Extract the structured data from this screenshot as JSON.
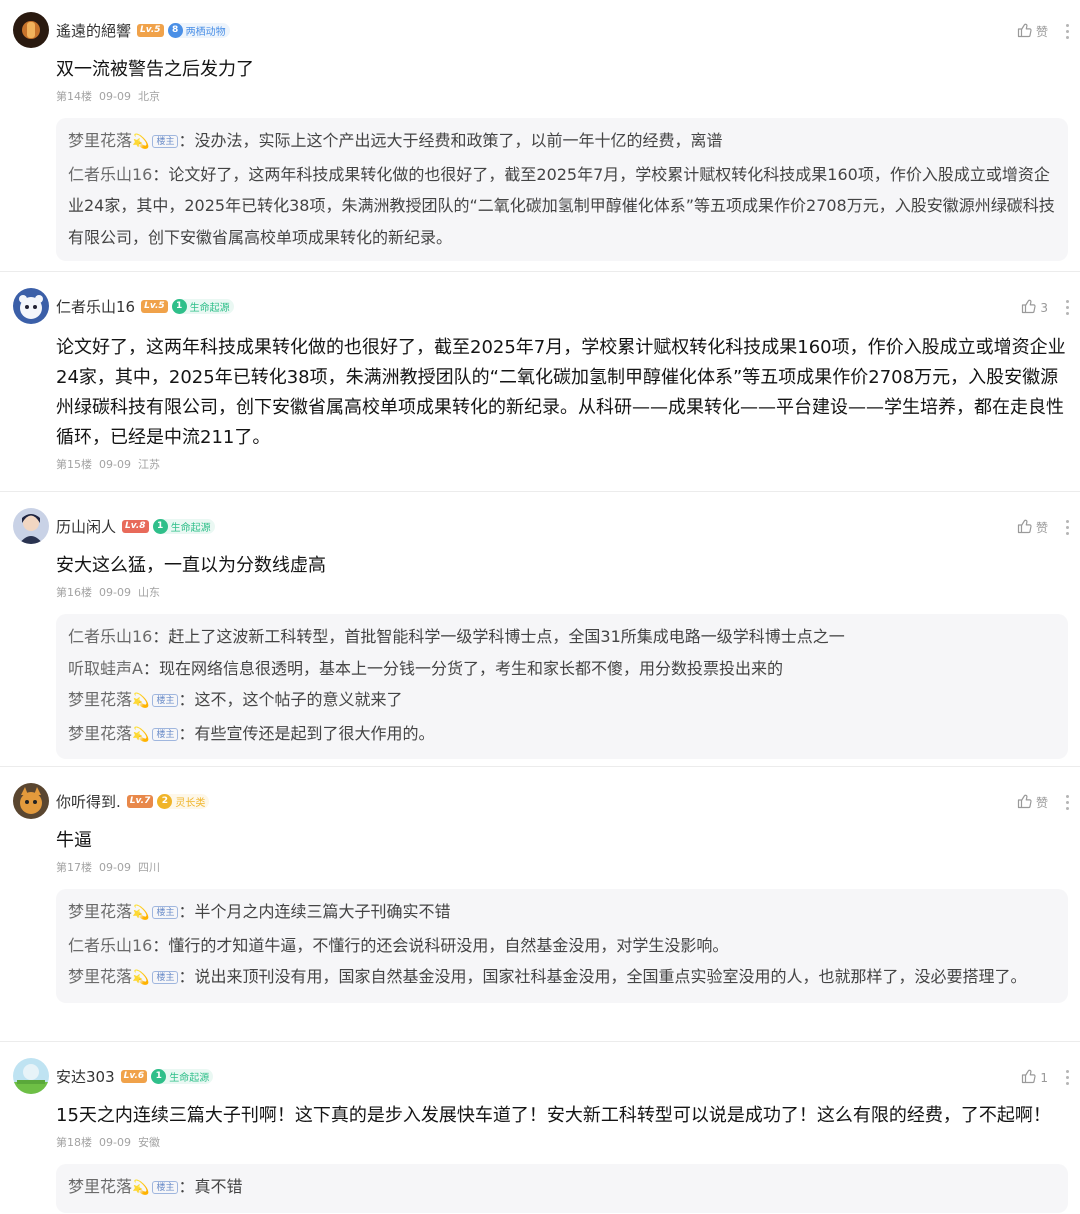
{
  "ui": {
    "colon": "：",
    "host_tag": "楼主",
    "spark": "💫",
    "icons": {
      "like": "thumb-up-icon",
      "more": "more-vertical-icon"
    }
  },
  "posts": [
    {
      "user": "遙遠的絕響",
      "level": "Lv.5",
      "level_color": "#f0a24a",
      "badge_num": "8",
      "badge_text": "两栖动物",
      "badge_color": "#4a8fe6",
      "like": "赞",
      "content": "双一流被警告之后发力了",
      "floor": "第14楼",
      "date": "09-09",
      "location": "北京",
      "replies": [
        {
          "name": "梦里花落",
          "host": true,
          "text": "没办法，实际上这个产出远大于经费和政策了，以前一年十亿的经费，离谱"
        },
        {
          "name": "仁者乐山16",
          "host": false,
          "text": "论文好了，这两年科技成果转化做的也很好了，截至2025年7月，学校累计赋权转化科技成果160项，作价入股成立或增资企业24家，其中，2025年已转化38项，朱满洲教授团队的“二氧化碳加氢制甲醇催化体系”等五项成果作价2708万元，入股安徽源州绿碳科技有限公司，创下安徽省属高校单项成果转化的新纪录。"
        }
      ]
    },
    {
      "user": "仁者乐山16",
      "level": "Lv.5",
      "level_color": "#f0a24a",
      "badge_num": "1",
      "badge_text": "生命起源",
      "badge_color": "#2fbf8a",
      "like": "3",
      "content": "论文好了，这两年科技成果转化做的也很好了，截至2025年7月，学校累计赋权转化科技成果160项，作价入股成立或增资企业24家，其中，2025年已转化38项，朱满洲教授团队的“二氧化碳加氢制甲醇催化体系”等五项成果作价2708万元，入股安徽源州绿碳科技有限公司，创下安徽省属高校单项成果转化的新纪录。从科研——成果转化——平台建设——学生培养，都在走良性循环，已经是中流211了。",
      "floor": "第15楼",
      "date": "09-09",
      "location": "江苏",
      "replies": []
    },
    {
      "user": "历山闲人",
      "level": "Lv.8",
      "level_color": "#e86a5a",
      "badge_num": "1",
      "badge_text": "生命起源",
      "badge_color": "#2fbf8a",
      "like": "赞",
      "content": "安大这么猛，一直以为分数线虚高",
      "floor": "第16楼",
      "date": "09-09",
      "location": "山东",
      "replies": [
        {
          "name": "仁者乐山16",
          "host": false,
          "text": "赶上了这波新工科转型，首批智能科学一级学科博士点，全国31所集成电路一级学科博士点之一"
        },
        {
          "name": "听取蛙声A",
          "host": false,
          "text": "现在网络信息很透明，基本上一分钱一分货了，考生和家长都不傻，用分数投票投出来的"
        },
        {
          "name": "梦里花落",
          "host": true,
          "text": "这不，这个帖子的意义就来了"
        },
        {
          "name": "梦里花落",
          "host": true,
          "text": "有些宣传还是起到了很大作用的。"
        }
      ]
    },
    {
      "user": "你听得到.",
      "level": "Lv.7",
      "level_color": "#e8884a",
      "badge_num": "2",
      "badge_text": "灵长类",
      "badge_color": "#f0b429",
      "like": "赞",
      "content": "牛逼",
      "floor": "第17楼",
      "date": "09-09",
      "location": "四川",
      "replies": [
        {
          "name": "梦里花落",
          "host": true,
          "text": "半个月之内连续三篇大子刊确实不错"
        },
        {
          "name": "仁者乐山16",
          "host": false,
          "text": "懂行的才知道牛逼，不懂行的还会说科研没用，自然基金没用，对学生没影响。"
        },
        {
          "name": "梦里花落",
          "host": true,
          "text": "说出来顶刊没有用，国家自然基金没用，国家社科基金没用，全国重点实验室没用的人，也就那样了，没必要搭理了。"
        }
      ]
    },
    {
      "user": "安达303",
      "level": "Lv.6",
      "level_color": "#f0a24a",
      "badge_num": "1",
      "badge_text": "生命起源",
      "badge_color": "#2fbf8a",
      "like": "1",
      "content": "15天之内连续三篇大子刊啊！这下真的是步入发展快车道了！安大新工科转型可以说是成功了！这么有限的经费，了不起啊！",
      "floor": "第18楼",
      "date": "09-09",
      "location": "安徽",
      "replies": [
        {
          "name": "梦里花落",
          "host": true,
          "text": "真不错"
        }
      ]
    }
  ]
}
